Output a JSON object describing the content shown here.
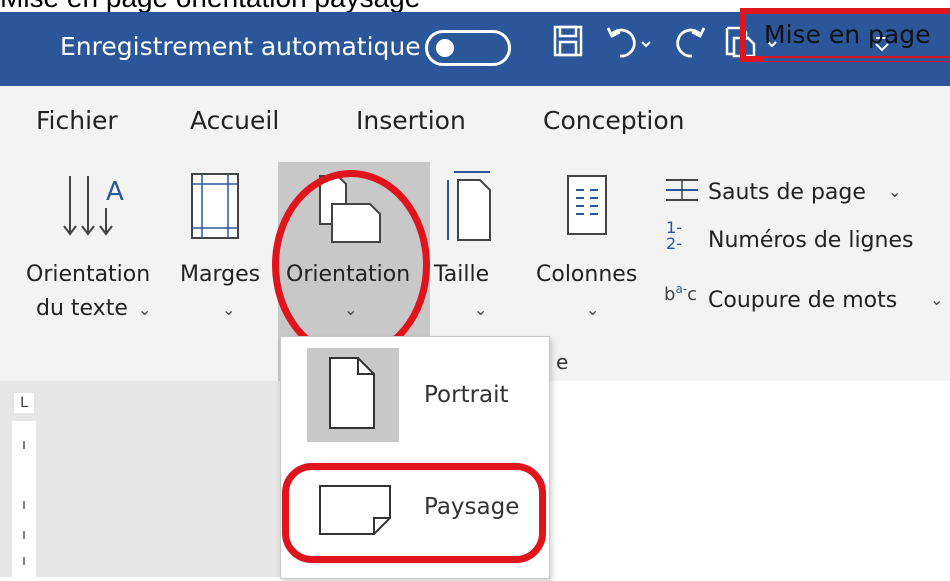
{
  "caption": "Mise en page orientation paysage",
  "titlebar": {
    "autosave_label": "Enregistrement automatique",
    "qa_icons": [
      "save-icon",
      "undo-icon",
      "redo-icon",
      "format-painter-icon",
      "customize-icon"
    ]
  },
  "tabs": [
    "Fichier",
    "Accueil",
    "Insertion",
    "Conception",
    "Mise en page"
  ],
  "ribbon": {
    "text_direction": {
      "line1": "Orientation",
      "line2": "du texte"
    },
    "margins": "Marges",
    "orientation": "Orientation",
    "size": "Taille",
    "columns": "Colonnes",
    "breaks": "Sauts de page",
    "line_numbers": "Numéros de lignes",
    "hyphenation": "Coupure de mots",
    "group_fragment": "e"
  },
  "dropdown": {
    "portrait": "Portrait",
    "landscape": "Paysage"
  },
  "ruler": {
    "corner": "L"
  },
  "colors": {
    "accent": "#2b579a",
    "highlight": "#e0141c",
    "ribbon_bg": "#f3f3f3"
  }
}
